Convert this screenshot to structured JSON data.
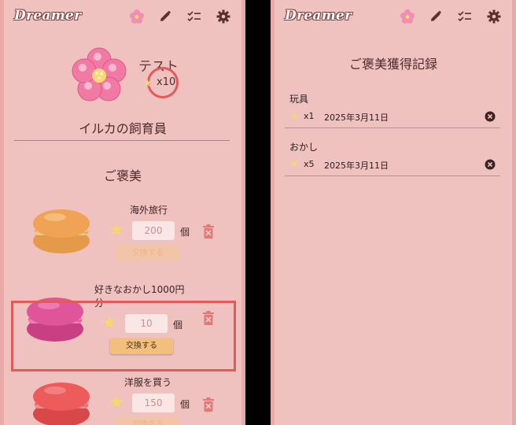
{
  "app": {
    "brand": "Dreamer"
  },
  "header": {
    "icons": [
      "flower-icon",
      "pencil-icon",
      "checklist-icon",
      "gear-icon"
    ]
  },
  "profile": {
    "name": "テスト",
    "star_count": "x10",
    "role": "イルカの飼育員"
  },
  "rewards": {
    "section_title": "ご褒美",
    "unit": "個",
    "items": [
      {
        "title": "海外旅行",
        "cost": "200",
        "exchange_label": "交換する",
        "exchange_enabled": false,
        "macaron_color": "#f0a356"
      },
      {
        "title": "好きなおかし1000円分",
        "cost": "10",
        "exchange_label": "交換する",
        "exchange_enabled": true,
        "macaron_color": "#e0559a"
      },
      {
        "title": "洋服を買う",
        "cost": "150",
        "exchange_label": "交換する",
        "exchange_enabled": false,
        "macaron_color": "#ee5b5b"
      }
    ]
  },
  "history": {
    "title": "ご褒美獲得記録",
    "groups": [
      {
        "name": "玩具",
        "entries": [
          {
            "qty": "x1",
            "date": "2025年3月11日"
          }
        ]
      },
      {
        "name": "おかし",
        "entries": [
          {
            "qty": "x5",
            "date": "2025年3月11日"
          }
        ]
      }
    ]
  },
  "colors": {
    "background": "#efc1bf",
    "highlight": "#e25b58",
    "star": "#f6d86b",
    "button_active": "#f3bf7c"
  }
}
